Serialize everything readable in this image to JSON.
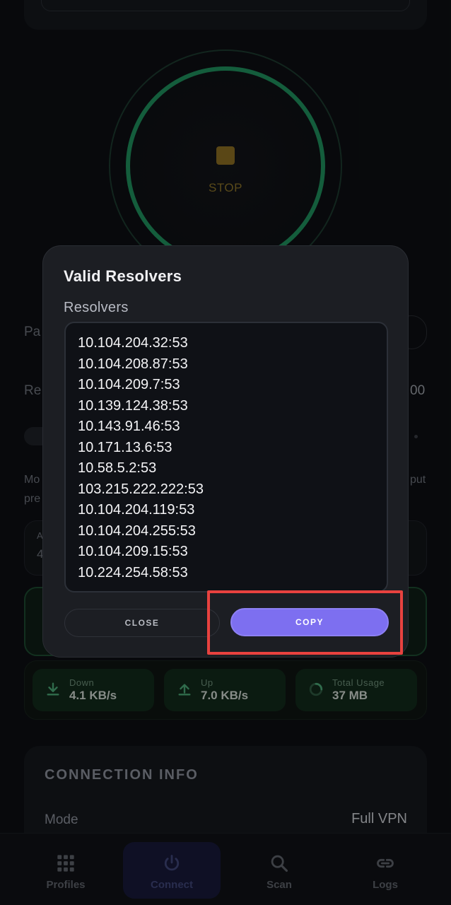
{
  "background": {
    "stop_label": "STOP",
    "fragments": {
      "pa": "Pa",
      "re": "Re",
      "hundred": "00",
      "mo": "Mo",
      "pre": "pre",
      "put": "put",
      "a": "A",
      "four": "4"
    },
    "stats": [
      {
        "label": "Down",
        "value": "4.1 KB/s",
        "icon": "download-icon"
      },
      {
        "label": "Up",
        "value": "7.0 KB/s",
        "icon": "upload-icon"
      },
      {
        "label": "Total Usage",
        "value": "37 MB",
        "icon": "usage-ring-icon"
      }
    ],
    "connection_info": {
      "title": "CONNECTION INFO",
      "mode_label": "Mode",
      "mode_value": "Full VPN"
    }
  },
  "bottom_nav": {
    "items": [
      {
        "label": "Profiles",
        "icon": "grid-icon"
      },
      {
        "label": "Connect",
        "icon": "power-icon",
        "active": true
      },
      {
        "label": "Scan",
        "icon": "search-icon"
      },
      {
        "label": "Logs",
        "icon": "link-icon"
      }
    ]
  },
  "dialog": {
    "title": "Valid Resolvers",
    "field_label": "Resolvers",
    "resolvers": [
      "10.104.204.32:53",
      "10.104.208.87:53",
      "10.104.209.7:53",
      "10.139.124.38:53",
      "10.143.91.46:53",
      "10.171.13.6:53",
      "10.58.5.2:53",
      "103.215.222.222:53",
      "10.104.204.119:53",
      "10.104.204.255:53",
      "10.104.209.15:53",
      "10.224.254.58:53"
    ],
    "close_label": "CLOSE",
    "copy_label": "COPY"
  },
  "colors": {
    "accent": "#7d6ff0",
    "highlight": "#e8423f",
    "connected_green": "#1f8f5d",
    "stop_amber": "#8a6d22"
  }
}
